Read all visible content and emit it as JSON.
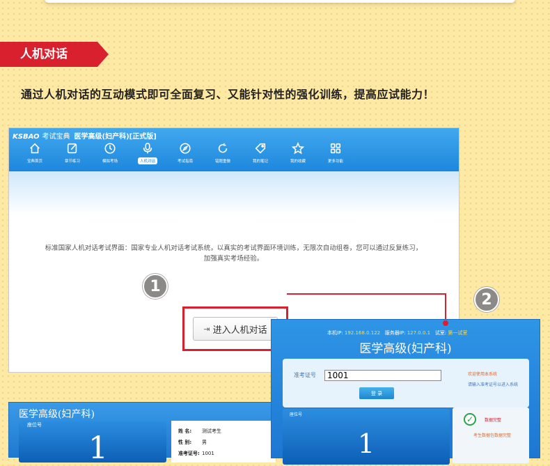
{
  "section": {
    "banner": "人机对话",
    "tagline": "通过人机对话的互动模式即可全面复习、又能针对性的强化训练，提高应试能力！"
  },
  "app": {
    "brand": "KSBAO",
    "brand_sub": "考试宝典",
    "product": "医学高级(妇产科)[正式版]",
    "nav": [
      {
        "label": "宝典首页",
        "icon": "home-icon"
      },
      {
        "label": "章节练习",
        "icon": "edit-icon"
      },
      {
        "label": "模拟考场",
        "icon": "clock-icon"
      },
      {
        "label": "人机对话",
        "icon": "microphone-icon",
        "active": true
      },
      {
        "label": "考试指南",
        "icon": "compass-icon"
      },
      {
        "label": "错题重做",
        "icon": "refresh-icon"
      },
      {
        "label": "我的笔记",
        "icon": "tag-icon"
      },
      {
        "label": "我的收藏",
        "icon": "star-icon"
      },
      {
        "label": "更多功能",
        "icon": "grid-icon"
      }
    ],
    "description": "标准国家人机对话考试界面：国家专业人机对话考试系统，以真实的考试界面环境训练，无限次自动组卷，您可以通过反复练习，加强真实考场经验。",
    "enter_button": "进入人机对话"
  },
  "badges": {
    "one": "1",
    "two": "2"
  },
  "login": {
    "ip_label": "本机IP:",
    "ip_value": "192.168.0.122",
    "server_label": "服务器IP:",
    "server_value": "127.0.0.1",
    "room_label": "试室:",
    "room_value": "第一试室",
    "title": "医学高级(妇产科)",
    "ticket_label": "准考证号",
    "ticket_value": "1001",
    "login_button": "登 录",
    "tip_welcome": "欢迎使用本系统",
    "tip_enter": "请输入准考证号以进入系统",
    "seat_label": "座位号",
    "seat_number": "1",
    "check_title": "数据完整",
    "check_sub": "考生数据包数据完整"
  },
  "exam": {
    "title": "医学高级(妇产科)",
    "seat_label": "座位号",
    "seat_number": "1",
    "name_label": "姓 名:",
    "name_value": "测试考生",
    "gender_label": "性 别:",
    "gender_value": "男",
    "ticket_label": "准考证号:",
    "ticket_value": "1001"
  }
}
